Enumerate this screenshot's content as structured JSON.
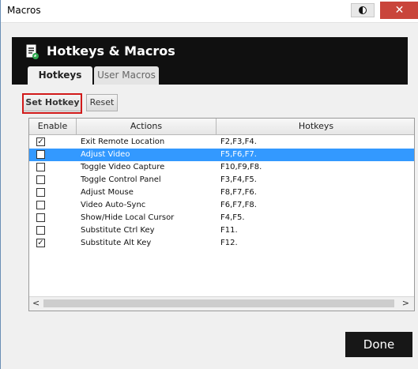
{
  "window": {
    "title": "Macros",
    "close_glyph": "✕",
    "theme_icon": "theme-toggle-icon"
  },
  "header": {
    "title": "Hotkeys & Macros",
    "icon": "macro-document-icon",
    "tabs": [
      {
        "label": "Hotkeys",
        "active": true
      },
      {
        "label": "User Macros",
        "active": false
      }
    ]
  },
  "toolbar": {
    "set_hotkey_label": "Set Hotkey",
    "reset_label": "Reset"
  },
  "table": {
    "columns": [
      "Enable",
      "Actions",
      "Hotkeys"
    ],
    "rows": [
      {
        "enabled": true,
        "action": "Exit Remote Location",
        "hotkeys": "F2,F3,F4."
      },
      {
        "enabled": false,
        "action": "Adjust Video",
        "hotkeys": "F5,F6,F7.",
        "selected": true
      },
      {
        "enabled": false,
        "action": "Toggle Video Capture",
        "hotkeys": "F10,F9,F8."
      },
      {
        "enabled": false,
        "action": "Toggle Control Panel",
        "hotkeys": "F3,F4,F5."
      },
      {
        "enabled": false,
        "action": "Adjust Mouse",
        "hotkeys": "F8,F7,F6."
      },
      {
        "enabled": false,
        "action": "Video Auto-Sync",
        "hotkeys": "F6,F7,F8."
      },
      {
        "enabled": false,
        "action": "Show/Hide Local Cursor",
        "hotkeys": "F4,F5."
      },
      {
        "enabled": false,
        "action": "Substitute Ctrl Key",
        "hotkeys": "F11."
      },
      {
        "enabled": true,
        "action": "Substitute Alt Key",
        "hotkeys": "F12."
      }
    ]
  },
  "scrollbar": {
    "left_glyph": "<",
    "right_glyph": ">"
  },
  "footer": {
    "done_label": "Done"
  },
  "colors": {
    "selection": "#3399ff",
    "header_bg": "#101010",
    "highlight_border": "#d11a1a",
    "close_button": "#c9453b"
  }
}
